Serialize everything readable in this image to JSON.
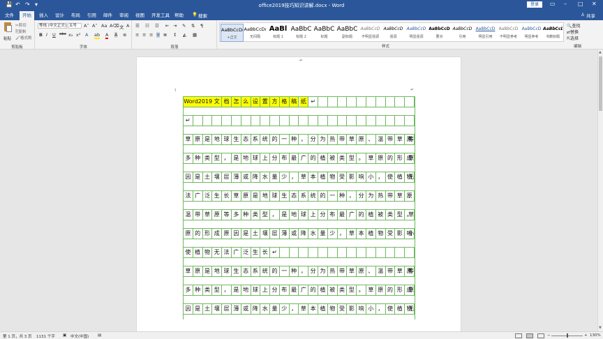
{
  "titlebar": {
    "title": "office2019技巧知识讲解.docx - Word",
    "login": "登录",
    "qa_save": "💾",
    "qa_undo": "↶",
    "qa_redo": "↷",
    "qa_more": "▾"
  },
  "tabs": [
    "文件",
    "开始",
    "插入",
    "设计",
    "布局",
    "引用",
    "邮件",
    "审阅",
    "视图",
    "开发工具",
    "帮助"
  ],
  "tell_me": "搜索",
  "share": "共享",
  "ribbon": {
    "clipboard": {
      "paste": "粘贴",
      "cut": "剪切",
      "copy": "复制",
      "painter": "格式刷",
      "label": "剪贴板"
    },
    "font": {
      "name": "等线 (中文正文)",
      "size": "五号",
      "label": "字体",
      "bold": "B",
      "italic": "I",
      "underline": "U",
      "strike": "abc"
    },
    "paragraph": {
      "label": "段落"
    },
    "styles": {
      "label": "样式",
      "items": [
        {
          "preview": "AaBbCcDı",
          "name": "+正文"
        },
        {
          "preview": "AaBbCcDı",
          "name": "无间隔"
        },
        {
          "preview": "AaBl",
          "name": "标题 1"
        },
        {
          "preview": "AaBbC",
          "name": "标题 2"
        },
        {
          "preview": "AaBbC",
          "name": "标题"
        },
        {
          "preview": "AaBbC",
          "name": "副标题"
        },
        {
          "preview": "AaBbCcD",
          "name": "不明显强调"
        },
        {
          "preview": "AaBbCcD",
          "name": "强调"
        },
        {
          "preview": "AaBbCcD",
          "name": "明显强调"
        },
        {
          "preview": "AaBbCcD",
          "name": "要点"
        },
        {
          "preview": "AaBbCcD",
          "name": "引用"
        },
        {
          "preview": "AaBbCcD",
          "name": "明显引用"
        },
        {
          "preview": "AaBbCcD",
          "name": "不明显参考"
        },
        {
          "preview": "AaBbCcD",
          "name": "明显参考"
        },
        {
          "preview": "AaBbCcD",
          "name": "书籍标题"
        }
      ]
    },
    "editing": {
      "find": "查找",
      "replace": "替换",
      "select": "选择",
      "label": "编辑"
    }
  },
  "document": {
    "rows": [
      {
        "cells": [
          "Word2019",
          "文",
          "档",
          "怎",
          "么",
          "设",
          "置",
          "方",
          "格",
          "稿",
          "纸",
          "↵"
        ],
        "highlight": true
      },
      {
        "cells": [
          "↵"
        ]
      },
      {
        "cells": [
          "草",
          "原",
          "是",
          "地",
          "球",
          "生",
          "态",
          "系",
          "统",
          "的",
          "一",
          "种",
          "，",
          "分",
          "为",
          "热",
          "带",
          "草",
          "原",
          "、",
          "温",
          "带",
          "草",
          "原",
          "等"
        ]
      },
      {
        "cells": [
          "多",
          "种",
          "类",
          "型",
          "，",
          "是",
          "地",
          "球",
          "上",
          "分",
          "布",
          "最",
          "广",
          "的",
          "植",
          "被",
          "类",
          "型",
          "。",
          "草",
          "原",
          "的",
          "形",
          "成",
          "原"
        ]
      },
      {
        "cells": [
          "因",
          "是",
          "土",
          "壤",
          "层",
          "薄",
          "或",
          "降",
          "水",
          "量",
          "少",
          "，",
          "草",
          "本",
          "植",
          "物",
          "受",
          "影",
          "响",
          "小",
          "，",
          "使",
          "植",
          "物",
          "无"
        ]
      },
      {
        "cells": [
          "法",
          "广",
          "泛",
          "生",
          "长",
          "草",
          "原",
          "是",
          "地",
          "球",
          "生",
          "态",
          "系",
          "统",
          "的",
          "一",
          "种",
          "，",
          "分",
          "为",
          "热",
          "带",
          "草",
          "原",
          "、"
        ]
      },
      {
        "cells": [
          "温",
          "带",
          "草",
          "原",
          "等",
          "多",
          "种",
          "类",
          "型",
          "，",
          "是",
          "地",
          "球",
          "上",
          "分",
          "布",
          "最",
          "广",
          "的",
          "植",
          "被",
          "类",
          "型",
          "。",
          "草"
        ]
      },
      {
        "cells": [
          "原",
          "的",
          "形",
          "成",
          "原",
          "因",
          "是",
          "土",
          "壤",
          "层",
          "薄",
          "或",
          "降",
          "水",
          "量",
          "少",
          "，",
          "草",
          "本",
          "植",
          "物",
          "受",
          "影",
          "响",
          "小"
        ]
      },
      {
        "cells": [
          "使",
          "植",
          "物",
          "无",
          "法",
          "广",
          "泛",
          "生",
          "长",
          "↵"
        ]
      },
      {
        "cells": [
          "草",
          "原",
          "是",
          "地",
          "球",
          "生",
          "态",
          "系",
          "统",
          "的",
          "一",
          "种",
          "，",
          "分",
          "为",
          "热",
          "带",
          "草",
          "原",
          "、",
          "温",
          "带",
          "草",
          "原",
          "等"
        ]
      },
      {
        "cells": [
          "多",
          "种",
          "类",
          "型",
          "，",
          "是",
          "地",
          "球",
          "上",
          "分",
          "布",
          "最",
          "广",
          "的",
          "植",
          "被",
          "类",
          "型",
          "。",
          "草",
          "原",
          "的",
          "形",
          "成",
          "原"
        ]
      },
      {
        "cells": [
          "因",
          "是",
          "土",
          "壤",
          "层",
          "薄",
          "或",
          "降",
          "水",
          "量",
          "少",
          "，",
          "草",
          "本",
          "植",
          "物",
          "受",
          "影",
          "响",
          "小",
          "，",
          "使",
          "植",
          "物",
          "无"
        ]
      }
    ]
  },
  "status": {
    "page": "第 1 页，共 3 页",
    "words": "1131 个字",
    "lang": "中文(中国)",
    "zoom": "130%"
  }
}
